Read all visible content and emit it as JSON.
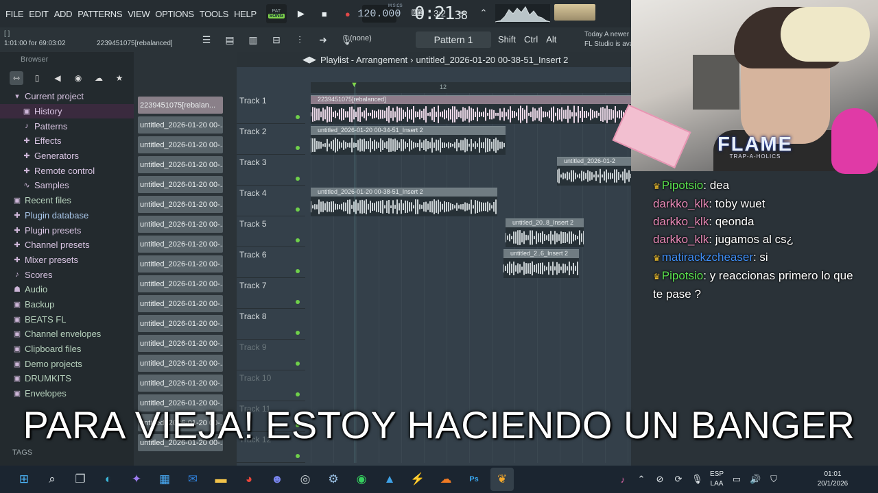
{
  "menu": [
    "FILE",
    "EDIT",
    "ADD",
    "PATTERNS",
    "VIEW",
    "OPTIONS",
    "TOOLS",
    "HELP"
  ],
  "transport": {
    "mode_label": "PAT",
    "song_label": "SONG",
    "tempo": "120.000",
    "time_main": "0:21",
    "time_small": "38",
    "time_format": "M:S:CS"
  },
  "toolbar2": {
    "hint_line1": "[ ]",
    "hint_line2": "1:01:00 for 69:03:02",
    "hint_name": "2239451075[rebalanced]",
    "none": "(none)",
    "pattern": "Pattern 1",
    "mods": [
      "Shift",
      "Ctrl",
      "Alt"
    ],
    "news_line1": "Today  A newer",
    "news_line2": "FL Studio is ava"
  },
  "browser": {
    "title": "Browser",
    "items": [
      {
        "label": "Current project",
        "icon": "folder-open",
        "sub": false
      },
      {
        "label": "History",
        "icon": "folder",
        "sub": true,
        "selected": true
      },
      {
        "label": "Patterns",
        "icon": "note",
        "sub": true
      },
      {
        "label": "Effects",
        "icon": "plug",
        "sub": true
      },
      {
        "label": "Generators",
        "icon": "plug",
        "sub": true
      },
      {
        "label": "Remote control",
        "icon": "plug",
        "sub": true
      },
      {
        "label": "Samples",
        "icon": "wave",
        "sub": true
      },
      {
        "label": "Recent files",
        "icon": "folder",
        "sub": false,
        "color": "green"
      },
      {
        "label": "Plugin database",
        "icon": "plug",
        "sub": false,
        "color": "cyan"
      },
      {
        "label": "Plugin presets",
        "icon": "plug",
        "sub": false
      },
      {
        "label": "Channel presets",
        "icon": "plug",
        "sub": false
      },
      {
        "label": "Mixer presets",
        "icon": "plug",
        "sub": false
      },
      {
        "label": "Scores",
        "icon": "note",
        "sub": false
      },
      {
        "label": "Audio",
        "icon": "person",
        "sub": false,
        "color": "green"
      },
      {
        "label": "Backup",
        "icon": "folder",
        "sub": false,
        "color": "green"
      },
      {
        "label": "BEATS FL",
        "icon": "folder",
        "sub": false,
        "color": "green"
      },
      {
        "label": "Channel envelopes",
        "icon": "folder",
        "sub": false,
        "color": "green"
      },
      {
        "label": "Clipboard files",
        "icon": "folder",
        "sub": false,
        "color": "green"
      },
      {
        "label": "Demo projects",
        "icon": "folder",
        "sub": false,
        "color": "green"
      },
      {
        "label": "DRUMKITS",
        "icon": "folder",
        "sub": false,
        "color": "green"
      },
      {
        "label": "Envelopes",
        "icon": "folder",
        "sub": false,
        "color": "green"
      }
    ],
    "tags": "TAGS"
  },
  "channels": [
    "2239451075[rebalan...",
    "untitled_2026-01-20 00-...",
    "untitled_2026-01-20 00-...",
    "untitled_2026-01-20 00-...",
    "untitled_2026-01-20 00-...",
    "untitled_2026-01-20 00-...",
    "untitled_2026-01-20 00-...",
    "untitled_2026-01-20 00-...",
    "untitled_2026-01-20 00-...",
    "untitled_2026-01-20 00-...",
    "untitled_2026-01-20 00-...",
    "untitled_2026-01-20 00-...",
    "untitled_2026-01-20 00-...",
    "untitled_2026-01-20 00-...",
    "untitled_2026-01-20 00-...",
    "untitled_2026-01-20 00-...",
    "untitled_2026-01-20 00-...",
    "untitled_2026-01-20 00-..."
  ],
  "playlist": {
    "title": "Playlist - Arrangement",
    "crumb": "untitled_2026-01-20 00-38-51_Insert 2",
    "ruler_mark": "12",
    "tracks": [
      {
        "name": "Track 1",
        "dim": false
      },
      {
        "name": "Track 2",
        "dim": false
      },
      {
        "name": "Track 3",
        "dim": false
      },
      {
        "name": "Track 4",
        "dim": false
      },
      {
        "name": "Track 5",
        "dim": false
      },
      {
        "name": "Track 6",
        "dim": false
      },
      {
        "name": "Track 7",
        "dim": false
      },
      {
        "name": "Track 8",
        "dim": false
      },
      {
        "name": "Track 9",
        "dim": true
      },
      {
        "name": "Track 10",
        "dim": true
      },
      {
        "name": "Track 11",
        "dim": true
      },
      {
        "name": "Track 12",
        "dim": true
      }
    ],
    "clips": [
      {
        "label": "2239451075[rebalanced]",
        "track": 0,
        "pink": true
      },
      {
        "label": "untitled_2026-01-20 00-34-51_Insert 2",
        "track": 1
      },
      {
        "label": "untitled_2026-01-2",
        "track": 2
      },
      {
        "label": "untitled_2026-01-20 00-38-51_Insert 2",
        "track": 3
      },
      {
        "label": "untitled_20..8_Insert 2",
        "track": 4
      },
      {
        "label": "untitled_2..6_Insert 2",
        "track": 5
      }
    ]
  },
  "overlay": {
    "logo": "FLAME",
    "logo_sub": "TRAP-A-HOLICS"
  },
  "chat": [
    {
      "user": "Pipotsio",
      "text": ": dea",
      "color": "#5be34f",
      "crown": true
    },
    {
      "user": "darkko_klk",
      "text": ": toby wuet",
      "color": "#e98ab8",
      "crown": false
    },
    {
      "user": "darkko_klk",
      "text": ": qeonda",
      "color": "#e98ab8",
      "crown": false
    },
    {
      "user": "darkko_klk",
      "text": ": jugamos al cs¿",
      "color": "#e98ab8",
      "crown": false
    },
    {
      "user": "matirackzcheaser",
      "text": ": si",
      "color": "#3f8ef5",
      "crown": true
    },
    {
      "user": "Pipotsio",
      "text": ": y reaccionas primero lo que te pase ?",
      "color": "#5be34f",
      "crown": true
    }
  ],
  "caption": "PARA VIEJA! ESTOY HACIENDO UN BANGER",
  "taskbar": {
    "lang1": "ESP",
    "lang2": "LAA",
    "time": "01:01",
    "date": "20/1/2026"
  }
}
